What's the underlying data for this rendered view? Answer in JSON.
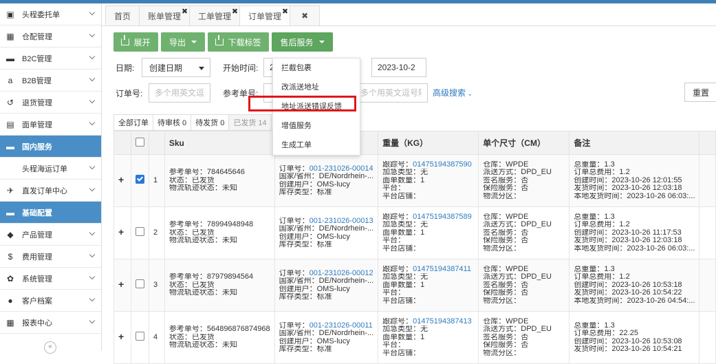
{
  "sidebar": {
    "items": [
      {
        "label": "头程委托单",
        "icon": "briefcase-icon",
        "glyph": "▣",
        "active": false,
        "sub": false
      },
      {
        "label": "仓配管理",
        "icon": "grid-icon",
        "glyph": "▦",
        "active": false,
        "sub": false
      },
      {
        "label": "B2C管理",
        "icon": "cart-icon",
        "glyph": "▬",
        "active": false,
        "sub": false
      },
      {
        "label": "B2B管理",
        "icon": "amazon-icon",
        "glyph": "a",
        "active": false,
        "sub": false
      },
      {
        "label": "退货管理",
        "icon": "undo-icon",
        "glyph": "↺",
        "active": false,
        "sub": false
      },
      {
        "label": "面单管理",
        "icon": "document-icon",
        "glyph": "▤",
        "active": false,
        "sub": false
      },
      {
        "label": "国内服务",
        "icon": "folder-icon",
        "glyph": "▬",
        "active": true,
        "sub": false
      },
      {
        "label": "头程海运订单",
        "icon": "",
        "glyph": "",
        "active": false,
        "sub": true
      },
      {
        "label": "直发订单中心",
        "icon": "plane-icon",
        "glyph": "✈",
        "active": false,
        "sub": false
      },
      {
        "label": "基础配置",
        "icon": "folder-icon",
        "glyph": "▬",
        "active": true,
        "sub": false
      },
      {
        "label": "产品管理",
        "icon": "tag-icon",
        "glyph": "◆",
        "active": false,
        "sub": false
      },
      {
        "label": "费用管理",
        "icon": "dollar-icon",
        "glyph": "$",
        "active": false,
        "sub": false
      },
      {
        "label": "系统管理",
        "icon": "gear-icon",
        "glyph": "✿",
        "active": false,
        "sub": false
      },
      {
        "label": "客户档案",
        "icon": "users-icon",
        "glyph": "●",
        "active": false,
        "sub": false
      },
      {
        "label": "报表中心",
        "icon": "table-icon",
        "glyph": "▦",
        "active": false,
        "sub": false
      }
    ],
    "collapse_glyph": "«"
  },
  "tabs": [
    {
      "label": "首页",
      "closable": false,
      "active": false
    },
    {
      "label": "账单管理",
      "closable": true,
      "active": false
    },
    {
      "label": "工单管理",
      "closable": true,
      "active": false
    },
    {
      "label": "订单管理",
      "closable": true,
      "active": true
    }
  ],
  "tab_close_all": "✖",
  "tab_close_glyph": "✖",
  "toolbar": {
    "expand": "展开",
    "export": "导出",
    "download_label": "下载标签",
    "after_sales": "售后服务"
  },
  "filters": {
    "date_label": "日期:",
    "date_select": "创建日期",
    "start_label": "开始时间:",
    "start_value": "2",
    "end_value": "2023-10-2",
    "order_no_label": "订单号:",
    "order_no_placeholder": "多个用英文逗",
    "ref_no_label": "参考单号:",
    "multi_placeholder": "多个用英文逗号隔",
    "advanced": "高级搜索",
    "reset": "重置"
  },
  "dropdown": {
    "items": [
      "拦截包裹",
      "改派送地址",
      "地址派送错误反馈",
      "增值服务",
      "生成工单"
    ]
  },
  "subtabs": [
    {
      "label": "全部订单",
      "muted": false
    },
    {
      "label": "待审核 0",
      "muted": false
    },
    {
      "label": "待发货 0",
      "muted": false
    },
    {
      "label": "已发货 14",
      "muted": true
    }
  ],
  "table": {
    "headers": [
      "",
      "",
      "",
      "Sku",
      "",
      "重量（KG）",
      "单个尺寸（CM）",
      "备注"
    ],
    "rows": [
      {
        "checked": true,
        "index": "1",
        "sku": [
          "参考单号：784645646",
          "状态：已发货",
          "物流轨迹状态：未知"
        ],
        "order": {
          "no_label": "订单号：",
          "no": "001-231026-00014",
          "lines": [
            "国家/省州：DE/Nordrhein-...",
            "创建用户：OMS-lucy",
            "库存类型：标准"
          ]
        },
        "track": {
          "label": "跟踪号：",
          "no": "01475194387590",
          "lines": [
            "加急类型：无",
            "面单数量：1",
            "平台：",
            "平台店铺："
          ]
        },
        "ship": [
          "仓库：WPDE",
          "派送方式：DPD_EU",
          "签名服务：否",
          "保险服务：否",
          "物流分区："
        ],
        "remark": [
          "总重量：1.3",
          "订单总费用：1.2",
          "创建时间：2023-10-26 12:01:55",
          "发货时间：2023-10-26 12:03:18",
          "本地发货时间：2023-10-26 06:03:..."
        ]
      },
      {
        "checked": false,
        "index": "2",
        "sku": [
          "参考单号：78994948948",
          "状态：已发货",
          "物流轨迹状态：未知"
        ],
        "order": {
          "no_label": "订单号：",
          "no": "001-231026-00013",
          "lines": [
            "国家/省州：DE/Nordrhein-...",
            "创建用户：OMS-lucy",
            "库存类型：标准"
          ]
        },
        "track": {
          "label": "跟踪号：",
          "no": "01475194387589",
          "lines": [
            "加急类型：无",
            "面单数量：1",
            "平台：",
            "平台店铺："
          ]
        },
        "ship": [
          "仓库：WPDE",
          "派送方式：DPD_EU",
          "签名服务：否",
          "保险服务：否",
          "物流分区："
        ],
        "remark": [
          "总重量：1.3",
          "订单总费用：1.2",
          "创建时间：2023-10-26 11:17:53",
          "发货时间：2023-10-26 12:03:18",
          "本地发货时间：2023-10-26 06:03:..."
        ]
      },
      {
        "checked": false,
        "index": "3",
        "sku": [
          "参考单号：87979894564",
          "状态：已发货",
          "物流轨迹状态：未知"
        ],
        "order": {
          "no_label": "订单号：",
          "no": "001-231026-00012",
          "lines": [
            "国家/省州：DE/Nordrhein-...",
            "创建用户：OMS-lucy",
            "库存类型：标准"
          ]
        },
        "track": {
          "label": "跟踪号：",
          "no": "01475194387411",
          "lines": [
            "加急类型：无",
            "面单数量：1",
            "平台：",
            "平台店铺："
          ]
        },
        "ship": [
          "仓库：WPDE",
          "派送方式：DPD_EU",
          "签名服务：否",
          "保险服务：否",
          "物流分区："
        ],
        "remark": [
          "总重量：1.3",
          "订单总费用：1.2",
          "创建时间：2023-10-26 10:53:18",
          "发货时间：2023-10-26 10:54:22",
          "本地发货时间：2023-10-26 04:54:..."
        ]
      },
      {
        "checked": false,
        "index": "4",
        "sku": [
          "参考单号：564896876874968",
          "状态：已发货",
          "物流轨迹状态：未知"
        ],
        "order": {
          "no_label": "订单号：",
          "no": "001-231026-00011",
          "lines": [
            "国家/省州：DE/Nordrhein-...",
            "创建用户：OMS-lucy",
            "库存类型：标准"
          ]
        },
        "track": {
          "label": "跟踪号：",
          "no": "01475194387413",
          "lines": [
            "加急类型：无",
            "面单数量：1",
            "平台：",
            "平台店铺："
          ]
        },
        "ship": [
          "仓库：WPDE",
          "派送方式：DPD_EU",
          "签名服务：否",
          "保险服务：否",
          "物流分区："
        ],
        "remark": [
          "总重量：1.3",
          "订单总费用：22.25",
          "创建时间：2023-10-26 10:53:08",
          "发货时间：2023-10-26 10:54:21"
        ]
      }
    ]
  }
}
